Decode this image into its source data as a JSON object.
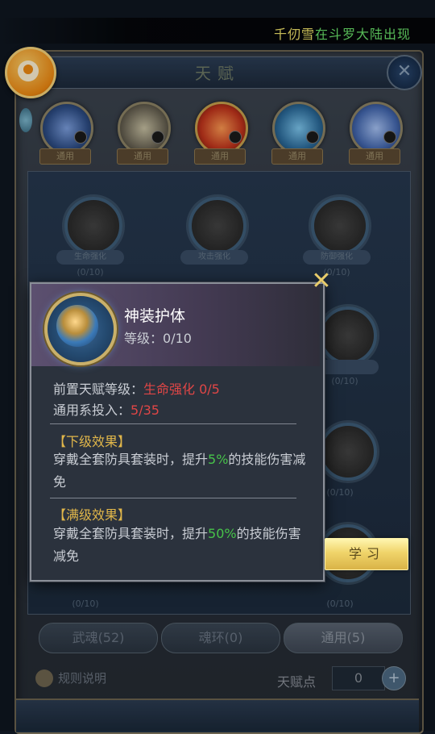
{
  "marquee": {
    "name": "千仞雪",
    "rest": "在斗罗大陆出现"
  },
  "panel": {
    "title": "天赋"
  },
  "categories": [
    {
      "label": "通用",
      "color": "#4b6fb0"
    },
    {
      "label": "通用",
      "color": "#8d8a7a"
    },
    {
      "label": "通用",
      "color": "#d4582a"
    },
    {
      "label": "通用",
      "color": "#3a7aa8"
    },
    {
      "label": "通用",
      "color": "#6a88c8"
    }
  ],
  "tree_nodes": [
    {
      "name": "生命强化",
      "count": "(0/10)"
    },
    {
      "name": "攻击强化",
      "count": ""
    },
    {
      "name": "防御强化",
      "count": "(0/10)"
    },
    {
      "name": "",
      "count": ""
    },
    {
      "name": "",
      "count": "(0/10)"
    },
    {
      "name": "",
      "count": "(0/10)"
    },
    {
      "name": "",
      "count": "(0/10)"
    },
    {
      "name": "",
      "count": "(0/10)"
    }
  ],
  "tabs": [
    {
      "label": "武魂(52)"
    },
    {
      "label": "魂环(0)"
    },
    {
      "label": "通用(5)"
    }
  ],
  "footer": {
    "rules_label": "规则说明",
    "talent_points_label": "天赋点",
    "talent_points_value": "0",
    "plus_symbol": "+"
  },
  "popup": {
    "skill_name": "神装护体",
    "level_label": "等级：",
    "level_value": "0/10",
    "close_symbol": "✕",
    "prereq_label": "前置天赋等级：",
    "prereq_value": "生命强化 0/5",
    "invest_label": "通用系投入：",
    "invest_value": "5/35",
    "next_title": "【下级效果】",
    "next_text_1": "穿戴全套防具套装时，提升",
    "next_pct": "5%",
    "next_text_2": "的技能伤害减免",
    "max_title": "【满级效果】",
    "max_text_1": "穿戴全套防具套装时，提升",
    "max_pct": "50%",
    "max_text_2": "的技能伤害减免"
  },
  "learn_button": {
    "label": "学习"
  },
  "colors": {
    "accent_gold": "#e0b64a",
    "red": "#e04646",
    "green": "#47c34a"
  }
}
